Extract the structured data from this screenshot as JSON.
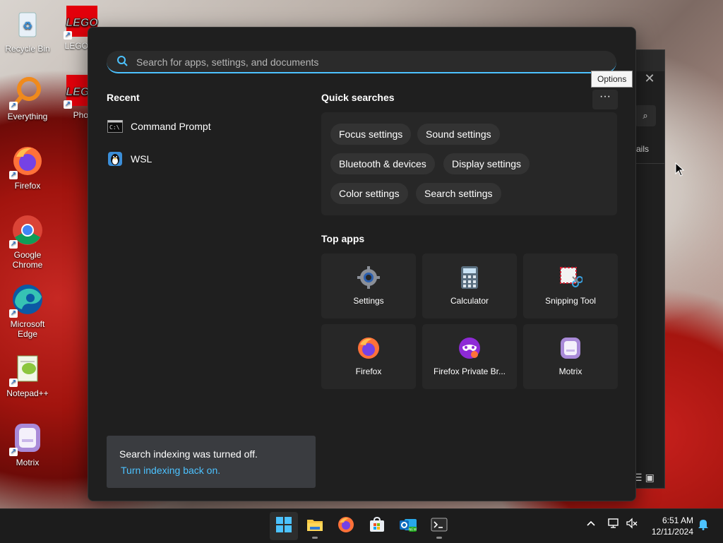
{
  "desktop": {
    "icons": [
      {
        "label": "Recycle Bin"
      },
      {
        "label": "LEGO Isl"
      },
      {
        "label": "Everything"
      },
      {
        "label": "Phot"
      },
      {
        "label": "Firefox"
      },
      {
        "label": "Google Chrome"
      },
      {
        "label": "Microsoft Edge"
      },
      {
        "label": "Notepad++"
      },
      {
        "label": "Motrix"
      }
    ]
  },
  "background_window": {
    "tab_text": "ails",
    "close_glyph": "✕"
  },
  "search": {
    "placeholder": "Search for apps, settings, and documents",
    "value": ""
  },
  "recent": {
    "title": "Recent",
    "items": [
      {
        "label": "Command Prompt",
        "icon": "command-prompt-icon"
      },
      {
        "label": "WSL",
        "icon": "wsl-penguin-icon"
      }
    ]
  },
  "quick_searches": {
    "title": "Quick searches",
    "chips": [
      {
        "label": "Focus settings"
      },
      {
        "label": "Sound settings"
      },
      {
        "label": "Bluetooth & devices"
      },
      {
        "label": "Display settings"
      },
      {
        "label": "Color settings"
      },
      {
        "label": "Search settings"
      }
    ]
  },
  "options": {
    "more_glyph": "···",
    "tooltip": "Options"
  },
  "top_apps": {
    "title": "Top apps",
    "apps": [
      {
        "label": "Settings",
        "icon": "gear-icon"
      },
      {
        "label": "Calculator",
        "icon": "calculator-icon"
      },
      {
        "label": "Snipping Tool",
        "icon": "snipping-tool-icon"
      },
      {
        "label": "Firefox",
        "icon": "firefox-icon"
      },
      {
        "label": "Firefox Private Br...",
        "icon": "firefox-private-icon"
      },
      {
        "label": "Motrix",
        "icon": "motrix-icon"
      }
    ]
  },
  "indexing": {
    "message": "Search indexing was turned off.",
    "link": "Turn indexing back on."
  },
  "taskbar": {
    "apps": [
      "start-icon",
      "file-explorer-icon",
      "firefox-icon",
      "microsoft-store-icon",
      "outlook-icon",
      "terminal-icon"
    ],
    "time": "6:51 AM",
    "date": "12/11/2024"
  },
  "colors": {
    "accent": "#4cc2ff",
    "panel_bg": "#1f1f1f",
    "tile_bg": "#272727",
    "taskbar_bg": "#1c1c1c"
  }
}
